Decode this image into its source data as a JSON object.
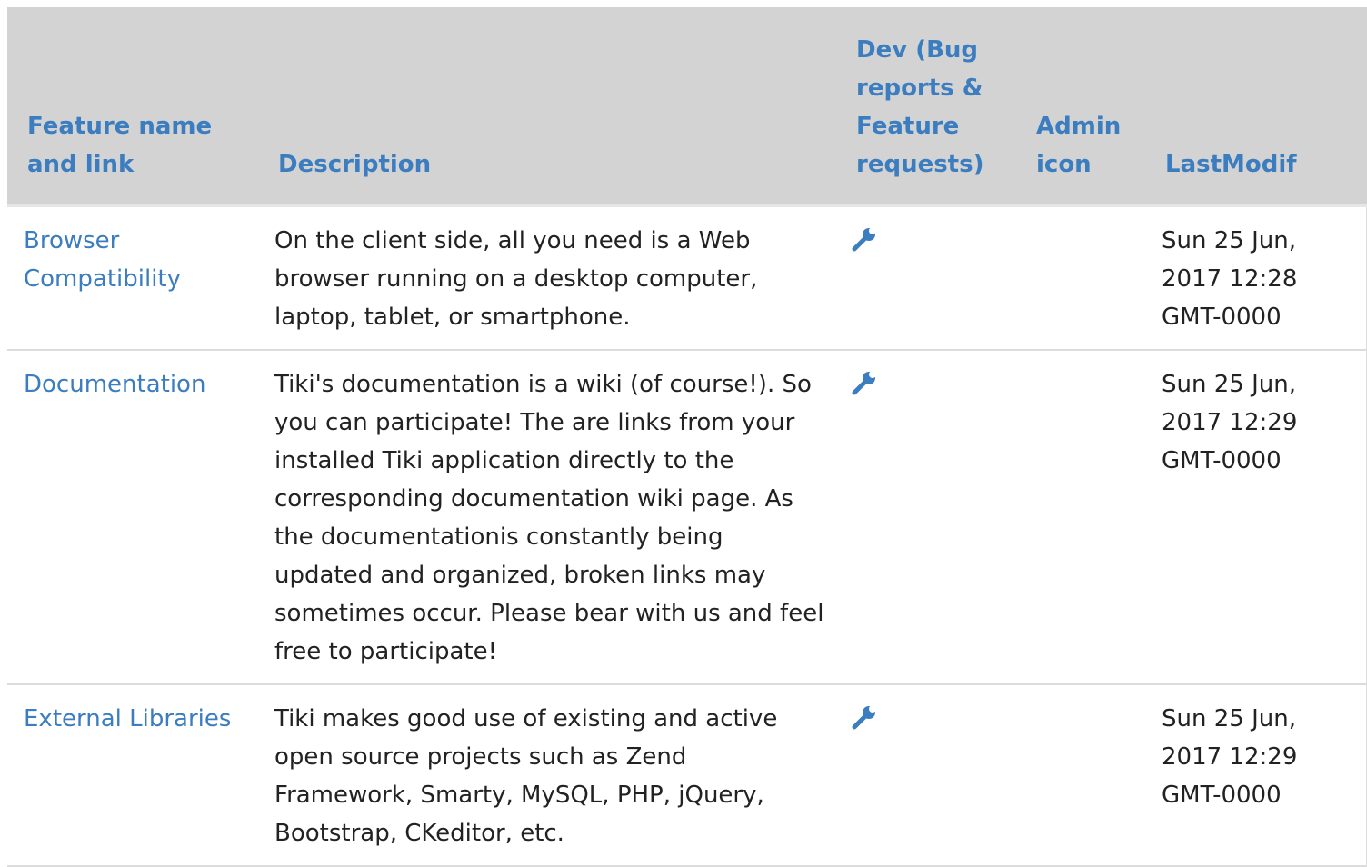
{
  "columns": {
    "name": "Feature name and link",
    "description": "Description",
    "dev": "Dev (Bug reports & Feature requests)",
    "admin": "Admin icon",
    "lastmodif": "LastModif"
  },
  "rows": [
    {
      "name": "Browser Compatibility",
      "description": "On the client side, all you need is a Web browser running on a desktop computer, laptop, tablet, or smartphone.",
      "dev_icon": "wrench-icon",
      "admin": "",
      "lastmodif": "Sun 25 Jun, 2017 12:28 GMT-0000"
    },
    {
      "name": "Documentation",
      "description": "Tiki's documentation is a wiki (of course!). So you can participate! The are links from your installed Tiki application directly to the corresponding documentation wiki page. As the documentationis constantly being updated and organized, broken links may sometimes occur. Please bear with us and feel free to participate!",
      "dev_icon": "wrench-icon",
      "admin": "",
      "lastmodif": "Sun 25 Jun, 2017 12:29 GMT-0000"
    },
    {
      "name": "External Libraries",
      "description": "Tiki makes good use of existing and active open source projects such as Zend Framework, Smarty, MySQL, PHP, jQuery, Bootstrap, CKeditor, etc.",
      "dev_icon": "wrench-icon",
      "admin": "",
      "lastmodif": "Sun 25 Jun, 2017 12:29 GMT-0000"
    }
  ],
  "colors": {
    "link": "#3b7dbf",
    "header_bg": "#d3d3d3",
    "text": "#222222"
  }
}
